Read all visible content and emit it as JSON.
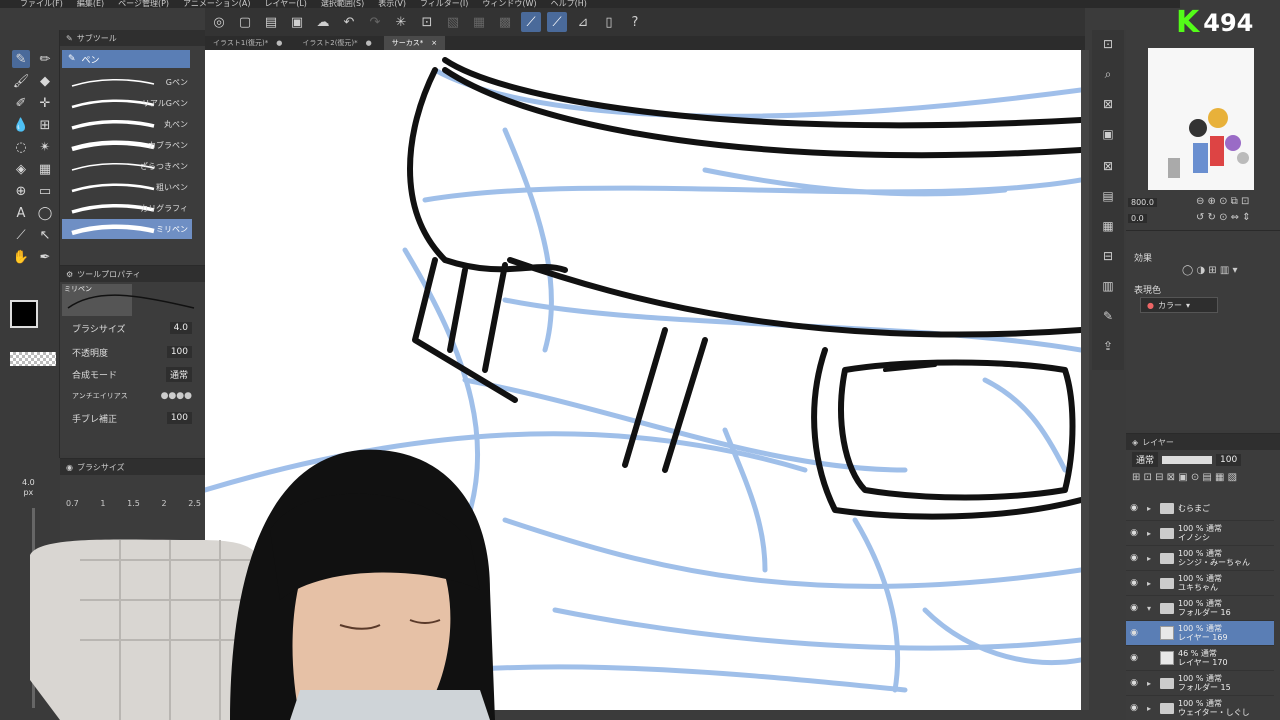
{
  "menu": [
    "ファイル(F)",
    "編集(E)",
    "ページ管理(P)",
    "アニメーション(A)",
    "レイヤー(L)",
    "選択範囲(S)",
    "表示(V)",
    "フィルター(I)",
    "ウィンドウ(W)",
    "ヘルプ(H)"
  ],
  "tabs": [
    {
      "label": "イラスト1(復元)*",
      "close": "●"
    },
    {
      "label": "イラスト2(復元)*",
      "close": "●"
    },
    {
      "label": "サーカス*",
      "close": "×"
    }
  ],
  "subtool": {
    "header": "サブツール",
    "category": "ペン",
    "brushes": [
      {
        "label": "Gペン",
        "selected": false
      },
      {
        "label": "リアルGペン",
        "selected": false
      },
      {
        "label": "丸ペン",
        "selected": false
      },
      {
        "label": "カブラペン",
        "selected": false
      },
      {
        "label": "ざらつきペン",
        "selected": false
      },
      {
        "label": "粗いペン",
        "selected": false
      },
      {
        "label": "カリグラフィ",
        "selected": false
      },
      {
        "label": "ミリペン",
        "selected": true
      }
    ]
  },
  "toolprop": {
    "header": "ツールプロパティ",
    "preview_label": "ミリペン",
    "brush_size_label": "ブラシサイズ",
    "brush_size": "4.0",
    "opacity_label": "不透明度",
    "opacity": "100",
    "blend_label": "合成モード",
    "blend": "通常",
    "aa_label": "アンチエイリアス",
    "stabilize_label": "手ブレ補正",
    "stabilize": "100"
  },
  "brushsize_panel": {
    "header": "ブラシサイズ",
    "current": "4.0",
    "unit": "px",
    "ticks": [
      "0.7",
      "1",
      "1.5",
      "2",
      "2.5"
    ]
  },
  "navigator": {
    "zoom": "800.0",
    "rotate": "0.0"
  },
  "effect": {
    "title": "効果",
    "color_label": "表現色",
    "color_value": "カラー"
  },
  "layer_panel": {
    "header": "レイヤー",
    "mode": "通常",
    "opacity": "100",
    "rows": [
      {
        "line1": "むらまご",
        "line2": "",
        "type": "folder",
        "expand": "▸",
        "selected": false
      },
      {
        "line1": "100 % 通常",
        "line2": "イノシシ",
        "type": "folder",
        "expand": "▸",
        "selected": false
      },
      {
        "line1": "100 % 通常",
        "line2": "シンジ・みーちゃん",
        "type": "folder",
        "expand": "▸",
        "selected": false
      },
      {
        "line1": "100 % 通常",
        "line2": "ユキちゃん",
        "type": "folder",
        "expand": "▸",
        "selected": false
      },
      {
        "line1": "100 % 通常",
        "line2": "フォルダー 16",
        "type": "folder",
        "expand": "▾",
        "selected": false
      },
      {
        "line1": "100 % 通常",
        "line2": "レイヤー 169",
        "type": "layer",
        "expand": "",
        "selected": true
      },
      {
        "line1": "46 % 通常",
        "line2": "レイヤー 170",
        "type": "layer",
        "expand": "",
        "selected": false
      },
      {
        "line1": "100 % 通常",
        "line2": "フォルダー 15",
        "type": "folder",
        "expand": "▸",
        "selected": false
      },
      {
        "line1": "100 % 通常",
        "line2": "ウェイター・しぐし",
        "type": "folder",
        "expand": "▸",
        "selected": false
      }
    ]
  },
  "overlay": {
    "badge_letter": "K",
    "badge_count": "494"
  }
}
